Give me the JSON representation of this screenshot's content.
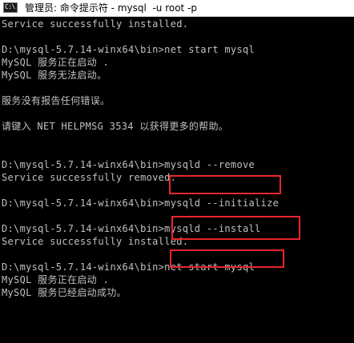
{
  "window": {
    "title": "管理员: 命令提示符 - mysql  -u root -p",
    "icon_label": "C:\\"
  },
  "console": {
    "lines": [
      "Service successfully installed.",
      "",
      "D:\\mysql-5.7.14-winx64\\bin>net start mysql",
      "MySQL 服务正在启动 .",
      "MySQL 服务无法启动。",
      "",
      "服务没有报告任何错误。",
      "",
      "请键入 NET HELPMSG 3534 以获得更多的帮助。",
      "",
      "",
      "D:\\mysql-5.7.14-winx64\\bin>mysqld --remove",
      "Service successfully removed.",
      "",
      "D:\\mysql-5.7.14-winx64\\bin>mysqld --initialize",
      "",
      "D:\\mysql-5.7.14-winx64\\bin>mysqld --install",
      "Service successfully installed.",
      "",
      "D:\\mysql-5.7.14-winx64\\bin>net start mysql",
      "MySQL 服务正在启动 .",
      "MySQL 服务已经启动成功。"
    ]
  },
  "highlight_color": "#e8262c",
  "text_color": "#c0c0c0",
  "background_color": "#000000"
}
